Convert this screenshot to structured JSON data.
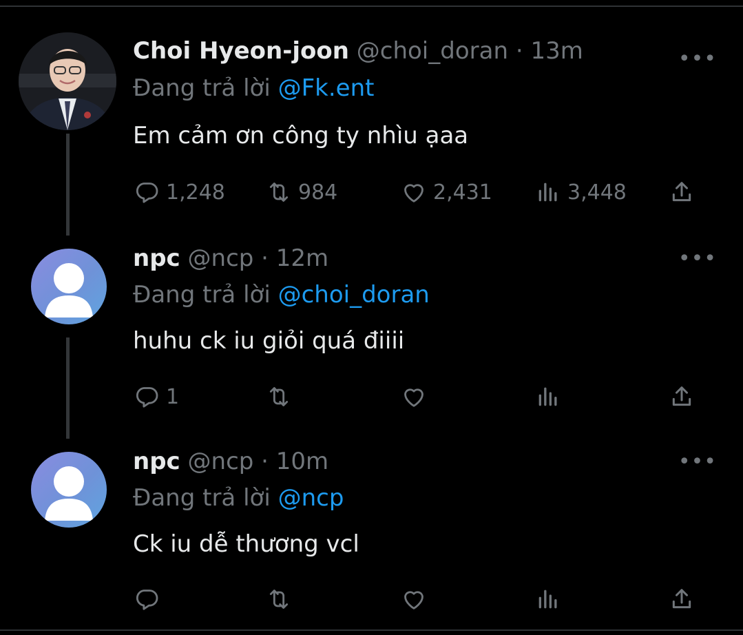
{
  "tweets": [
    {
      "name": "Choi Hyeon-joon",
      "handle": "@choi_doran",
      "dot": "·",
      "time": "13m",
      "more": "•••",
      "reply_prefix": "Đang trả lời",
      "reply_to": "@Fk.ent",
      "text": "Em cảm ơn công ty nhìu ạaa",
      "replies": "1,248",
      "retweets": "984",
      "likes": "2,431",
      "views": "3,448"
    },
    {
      "name": "npc",
      "handle": "@ncp",
      "dot": "·",
      "time": "12m",
      "more": "•••",
      "reply_prefix": "Đang trả lời",
      "reply_to": "@choi_doran",
      "text": "huhu ck iu giỏi quá điiii",
      "replies": "1",
      "retweets": "",
      "likes": "",
      "views": ""
    },
    {
      "name": "npc",
      "handle": "@ncp",
      "dot": "·",
      "time": "10m",
      "more": "•••",
      "reply_prefix": "Đang trả lời",
      "reply_to": "@ncp",
      "text": "Ck iu dễ thương vcl",
      "replies": "",
      "retweets": "",
      "likes": "",
      "views": ""
    }
  ],
  "icons": {
    "reply": "reply-icon",
    "retweet": "retweet-icon",
    "like": "heart-icon",
    "views": "views-icon",
    "share": "share-icon",
    "more": "more-icon"
  },
  "colors": {
    "background": "#000000",
    "text": "#e7e9ea",
    "muted": "#71767b",
    "link": "#1d9bf0",
    "thread_line": "#333639"
  }
}
